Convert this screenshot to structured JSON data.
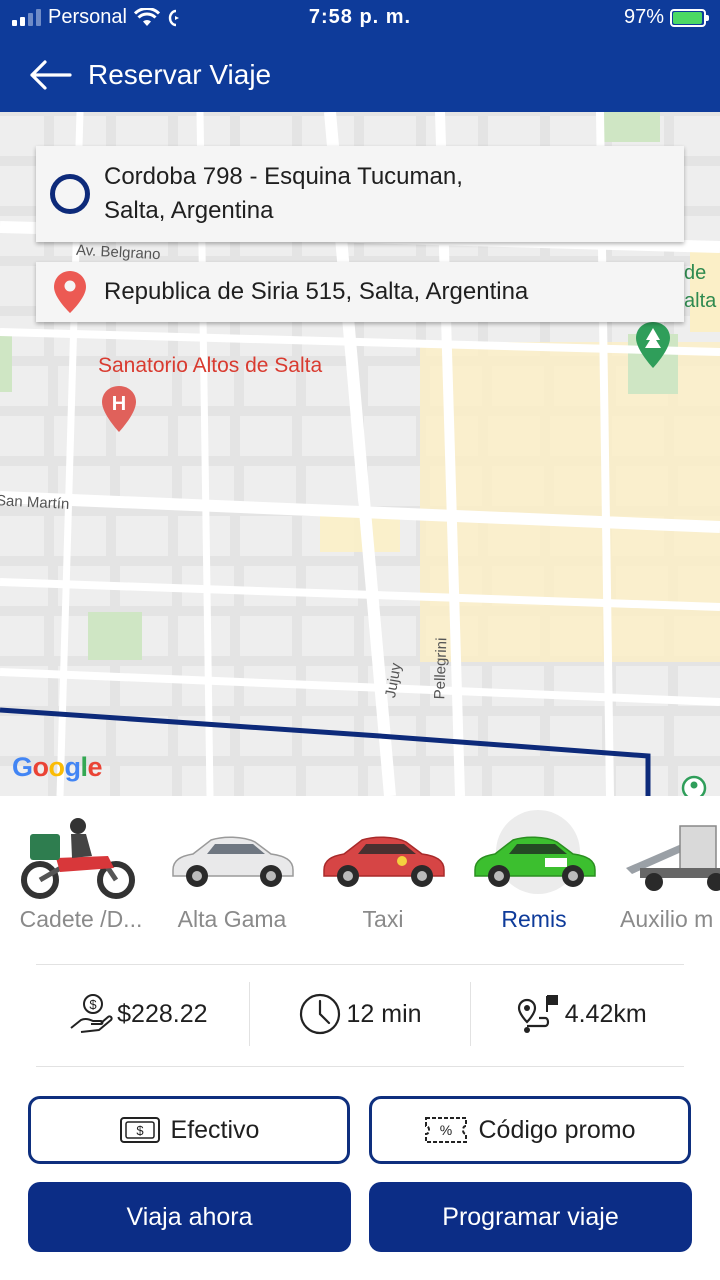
{
  "status_bar": {
    "carrier": "Personal",
    "time": "7:58 p. m.",
    "battery_percent": "97%",
    "battery_level": 0.97,
    "icons": [
      "signal-icon",
      "wifi-icon",
      "call-forward-icon",
      "battery-charging-icon"
    ]
  },
  "header": {
    "title": "Reservar Viaje",
    "back_icon": "arrow-left-icon"
  },
  "trip": {
    "origin_line1": "Cordoba 798 - Esquina Tucuman,",
    "origin_line2": "Salta, Argentina",
    "destination": "Republica de Siria 515, Salta, Argentina"
  },
  "map": {
    "labels": {
      "belgrano": "Av. Belgrano",
      "san_martin": "San Martín",
      "jujuy": "Jujuy",
      "pellegrini": "Pellegrini",
      "poi": "Sanatorio Altos de Salta",
      "edge_top": "de",
      "edge_bottom": "alta"
    },
    "logo": {
      "G": "G",
      "o1": "o",
      "o2": "o",
      "g": "g",
      "l": "l",
      "e": "e"
    },
    "colors": {
      "route": "#0d2a7a",
      "poi": "#d93b30",
      "park": "#cfe6c4",
      "block_yellow": "#fbefc7"
    }
  },
  "vehicles": [
    {
      "label": "Cadete /D...",
      "icon": "motorbike-courier-icon",
      "selected": false
    },
    {
      "label": "Alta Gama",
      "icon": "luxury-car-icon",
      "selected": false
    },
    {
      "label": "Taxi",
      "icon": "taxi-car-icon",
      "selected": false
    },
    {
      "label": "Remis",
      "icon": "remis-car-icon",
      "selected": true
    },
    {
      "label": "Auxilio m",
      "icon": "tow-truck-icon",
      "selected": false
    }
  ],
  "fare": {
    "price": "$228.22",
    "duration": "12 min",
    "distance": "4.42km"
  },
  "payment": {
    "cash_label": "Efectivo",
    "promo_label": "Código promo"
  },
  "actions": {
    "ride_now": "Viaja ahora",
    "schedule": "Programar viaje"
  },
  "theme": {
    "primary": "#0e3b9a",
    "button_primary": "#0c2d86",
    "selected_label": "#0e3b9a"
  }
}
